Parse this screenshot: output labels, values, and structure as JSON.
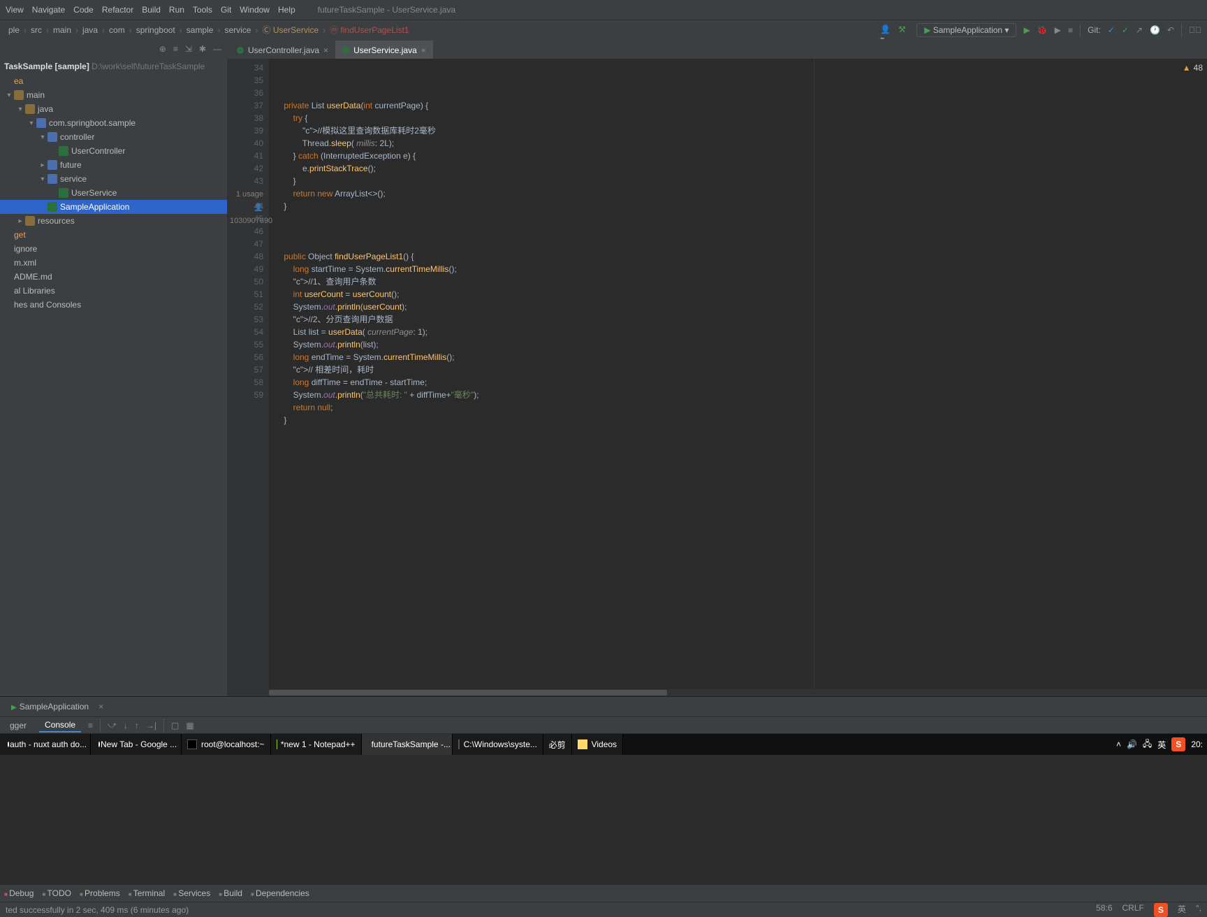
{
  "window": {
    "title": "futureTaskSample - UserService.java"
  },
  "menu": [
    "View",
    "Navigate",
    "Code",
    "Refactor",
    "Build",
    "Run",
    "Tools",
    "Git",
    "Window",
    "Help"
  ],
  "breadcrumbs": [
    "ple",
    "src",
    "main",
    "java",
    "com",
    "springboot",
    "sample",
    "service",
    "UserService",
    "findUserPageList1"
  ],
  "run_config": "SampleApplication",
  "git_label": "Git:",
  "project": {
    "root_label": "TaskSample [sample]",
    "root_path": "D:\\work\\self\\futureTaskSample",
    "tree": [
      {
        "indent": 0,
        "arrow": "",
        "icon": "",
        "label": "ea",
        "muted": true
      },
      {
        "indent": 0,
        "arrow": "▾",
        "icon": "folder",
        "label": "main"
      },
      {
        "indent": 1,
        "arrow": "▾",
        "icon": "folder",
        "label": "java"
      },
      {
        "indent": 2,
        "arrow": "▾",
        "icon": "pkg",
        "label": "com.springboot.sample"
      },
      {
        "indent": 3,
        "arrow": "▾",
        "icon": "pkg",
        "label": "controller"
      },
      {
        "indent": 4,
        "arrow": "",
        "icon": "class",
        "label": "UserController"
      },
      {
        "indent": 3,
        "arrow": "▸",
        "icon": "pkg",
        "label": "future"
      },
      {
        "indent": 3,
        "arrow": "▾",
        "icon": "pkg",
        "label": "service"
      },
      {
        "indent": 4,
        "arrow": "",
        "icon": "class",
        "label": "UserService"
      },
      {
        "indent": 3,
        "arrow": "",
        "icon": "class",
        "label": "SampleApplication",
        "selected": true
      },
      {
        "indent": 1,
        "arrow": "▸",
        "icon": "res",
        "label": "resources"
      },
      {
        "indent": 0,
        "arrow": "",
        "icon": "",
        "label": "get",
        "muted": true
      },
      {
        "indent": 0,
        "arrow": "",
        "icon": "",
        "label": "ignore"
      },
      {
        "indent": 0,
        "arrow": "",
        "icon": "",
        "label": "m.xml"
      },
      {
        "indent": 0,
        "arrow": "",
        "icon": "",
        "label": "ADME.md"
      },
      {
        "indent": 0,
        "arrow": "",
        "icon": "",
        "label": "al Libraries"
      },
      {
        "indent": 0,
        "arrow": "",
        "icon": "",
        "label": "hes and Consoles"
      }
    ]
  },
  "tabs": [
    {
      "label": "UserController.java",
      "active": false
    },
    {
      "label": "UserService.java",
      "active": true
    }
  ],
  "editor": {
    "first_line": 34,
    "usage": "1 usage",
    "author": "1030907690",
    "warnings": "48",
    "lines": [
      "    private List userData(int currentPage) {",
      "        try {",
      "            //模拟这里查询数据库耗时2毫秒",
      "            Thread.sleep( millis: 2L);",
      "        } catch (InterruptedException e) {",
      "            e.printStackTrace();",
      "        }",
      "        return new ArrayList<>();",
      "    }",
      "",
      "",
      "    public Object findUserPageList1() {",
      "        long startTime = System.currentTimeMillis();",
      "        //1、查询用户条数",
      "        int userCount = userCount();",
      "        System.out.println(userCount);",
      "        //2、分页查询用户数据",
      "        List list = userData( currentPage: 1);",
      "        System.out.println(list);",
      "        long endTime = System.currentTimeMillis();",
      "        // 相差时间，耗时",
      "        long diffTime = endTime - startTime;",
      "        System.out.println(\"总共耗时: \" + diffTime+\"毫秒\");",
      "        return null;",
      "    }",
      ""
    ]
  },
  "debug": {
    "tab": "SampleApplication",
    "subtabs": [
      "gger",
      "Console"
    ],
    "active_sub": "Console"
  },
  "bottom_tools": [
    "Debug",
    "TODO",
    "Problems",
    "Terminal",
    "Services",
    "Build",
    "Dependencies"
  ],
  "status": {
    "msg": "ted successfully in 2 sec, 409 ms (6 minutes ago)",
    "pos": "58:6",
    "eol": "CRLF",
    "lang": "英"
  },
  "taskbar": [
    {
      "icon": "chrome",
      "label": "auth - nuxt auth do..."
    },
    {
      "icon": "chrome",
      "label": "New Tab - Google ..."
    },
    {
      "icon": "term",
      "label": "root@localhost:~"
    },
    {
      "icon": "npp",
      "label": "*new 1 - Notepad++"
    },
    {
      "icon": "ij",
      "label": "futureTaskSample -...",
      "active": true
    },
    {
      "icon": "term",
      "label": "C:\\Windows\\syste..."
    },
    {
      "icon": "",
      "label": "必剪"
    },
    {
      "icon": "folder",
      "label": "Videos"
    }
  ],
  "tray": {
    "ime": "英",
    "time": "20:"
  }
}
